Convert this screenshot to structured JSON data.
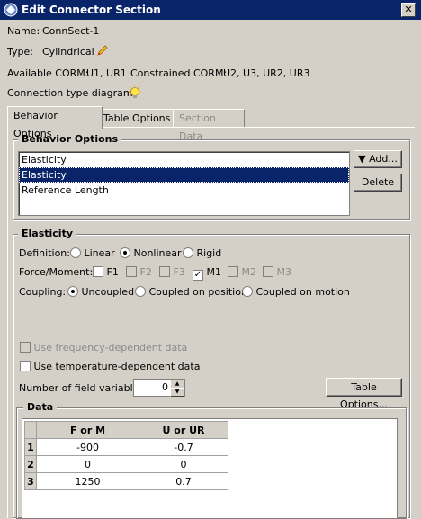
{
  "window": {
    "title": "Edit Connector Section"
  },
  "header": {
    "name_label": "Name:",
    "name_value": "ConnSect-1",
    "type_label": "Type:",
    "type_value": "Cylindrical",
    "available_corm_label": "Available CORM:",
    "available_corm_value": "U1, UR1",
    "constrained_corm_label": "Constrained CORM:",
    "constrained_corm_value": "U2, U3, UR2, UR3",
    "diagram_label": "Connection type diagram:"
  },
  "tabs": [
    {
      "label": "Behavior Options",
      "state": "active"
    },
    {
      "label": "Table Options",
      "state": "normal"
    },
    {
      "label": "Section Data",
      "state": "disabled"
    }
  ],
  "behavior_options": {
    "title": "Behavior Options",
    "items": [
      "Elasticity",
      "Elasticity",
      "Reference Length"
    ],
    "selected_index": 1,
    "add_button": "Add...",
    "delete_button": "Delete"
  },
  "elasticity": {
    "title": "Elasticity",
    "definition_label": "Definition:",
    "definition_options": [
      "Linear",
      "Nonlinear",
      "Rigid"
    ],
    "definition_selected": "Nonlinear",
    "force_moment_label": "Force/Moment:",
    "force_moment": [
      {
        "label": "F1",
        "checked": false,
        "enabled": true
      },
      {
        "label": "F2",
        "checked": false,
        "enabled": false
      },
      {
        "label": "F3",
        "checked": false,
        "enabled": false
      },
      {
        "label": "M1",
        "checked": true,
        "enabled": true
      },
      {
        "label": "M2",
        "checked": false,
        "enabled": false
      },
      {
        "label": "M3",
        "checked": false,
        "enabled": false
      }
    ],
    "coupling_label": "Coupling:",
    "coupling_options": [
      "Uncoupled",
      "Coupled on position",
      "Coupled on motion"
    ],
    "coupling_selected": "Uncoupled",
    "frequency_label": "Use frequency-dependent data",
    "temperature_label": "Use temperature-dependent data",
    "field_vars_label": "Number of field variables:",
    "field_vars_value": "0",
    "table_options_button": "Table Options..."
  },
  "data": {
    "title": "Data",
    "columns": [
      "F or M",
      "U or UR"
    ],
    "rows": [
      {
        "index": "1",
        "values": [
          "-900",
          "-0.7"
        ]
      },
      {
        "index": "2",
        "values": [
          "0",
          "0"
        ]
      },
      {
        "index": "3",
        "values": [
          "1250",
          "0.7"
        ]
      }
    ]
  }
}
